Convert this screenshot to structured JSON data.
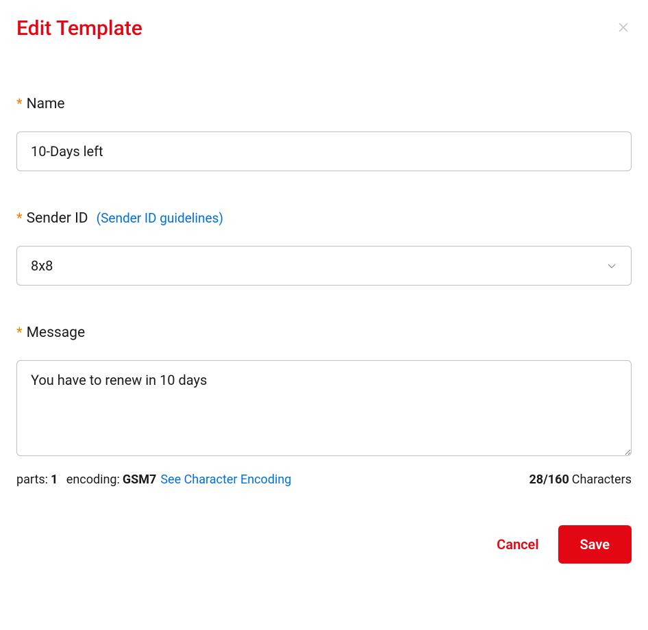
{
  "header": {
    "title": "Edit Template"
  },
  "form": {
    "name": {
      "label": "Name",
      "value": "10-Days left"
    },
    "sender_id": {
      "label": "Sender ID",
      "guidelines_text": "(Sender ID guidelines)",
      "value": "8x8"
    },
    "message": {
      "label": "Message",
      "value": "You have to renew in 10 days"
    }
  },
  "info": {
    "parts_label": "parts:",
    "parts_value": "1",
    "encoding_label": "encoding:",
    "encoding_value": "GSM7",
    "encoding_link": "See Character Encoding",
    "char_count": "28/160",
    "char_label": "Characters"
  },
  "actions": {
    "cancel": "Cancel",
    "save": "Save"
  }
}
